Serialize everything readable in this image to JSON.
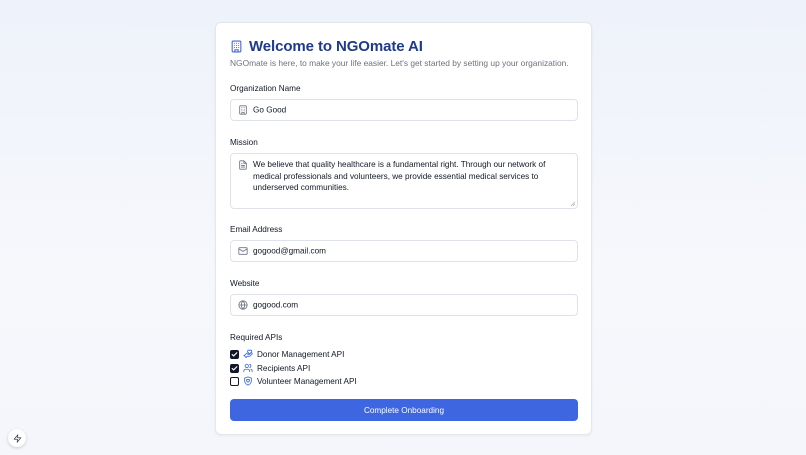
{
  "header": {
    "title": "Welcome to NGOmate AI",
    "subtitle": "NGOmate is here, to make your life easier. Let's get started by setting up your organization."
  },
  "form": {
    "organization": {
      "label": "Organization Name",
      "value": "Go Good",
      "icon": "building-icon"
    },
    "mission": {
      "label": "Mission",
      "value": "We believe that quality healthcare is a fundamental right. Through our network of medical professionals and volunteers, we provide essential medical services to underserved communities.",
      "icon": "document-icon"
    },
    "email": {
      "label": "Email Address",
      "value": "gogood@gmail.com",
      "icon": "mail-icon"
    },
    "website": {
      "label": "Website",
      "value": "gogood.com",
      "icon": "globe-icon"
    },
    "apis": {
      "label": "Required APIs",
      "items": [
        {
          "label": "Donor Management API",
          "checked": true,
          "icon": "hand-heart-icon"
        },
        {
          "label": "Recipients API",
          "checked": true,
          "icon": "users-icon"
        },
        {
          "label": "Volunteer Management API",
          "checked": false,
          "icon": "shield-heart-icon"
        }
      ]
    },
    "submit_label": "Complete Onboarding"
  },
  "colors": {
    "primary": "#3d66e0",
    "title": "#1e3a8a",
    "api_icon": "#3d66e0",
    "checkbox": "#111827"
  },
  "floating": {
    "icon": "lightning-bolt-icon"
  }
}
